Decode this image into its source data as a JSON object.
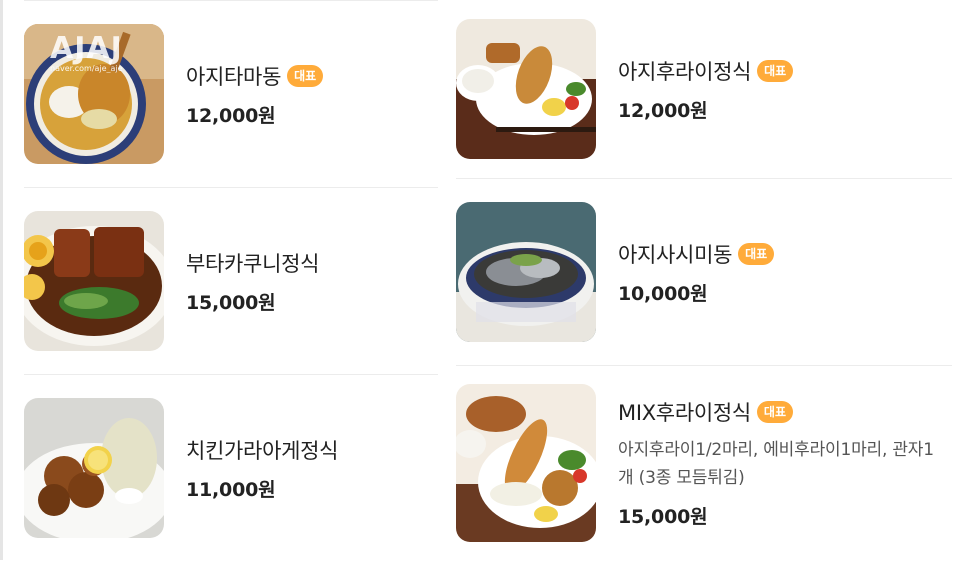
{
  "left_menu": [
    {
      "name": "아지타마동",
      "badge": "대표",
      "price": "12,000원",
      "image": "ajitama-don-photo"
    },
    {
      "name": "부타카쿠니정식",
      "badge": "",
      "price": "15,000원",
      "image": "butakakuni-set-photo"
    },
    {
      "name": "치킨가라아게정식",
      "badge": "",
      "price": "11,000원",
      "image": "chicken-karaage-set-photo"
    }
  ],
  "right_menu": [
    {
      "name": "아지후라이정식",
      "badge": "대표",
      "price": "12,000원",
      "image": "aji-fry-set-photo"
    },
    {
      "name": "아지사시미동",
      "badge": "대표",
      "price": "10,000원",
      "image": "aji-sashimi-don-photo"
    },
    {
      "name": "MIX후라이정식",
      "badge": "대표",
      "description": "아지후라이1/2마리, 에비후라이1마리, 관자1개 (3종 모듬튀김)",
      "price": "15,000원",
      "image": "mix-fry-set-photo"
    }
  ],
  "watermark": {
    "logo": "AJAJ",
    "url": "naver.com/aje_aje"
  },
  "colors": {
    "badge": "#ffab3a",
    "text": "#222222",
    "description": "#555555",
    "divider": "#ececec"
  }
}
